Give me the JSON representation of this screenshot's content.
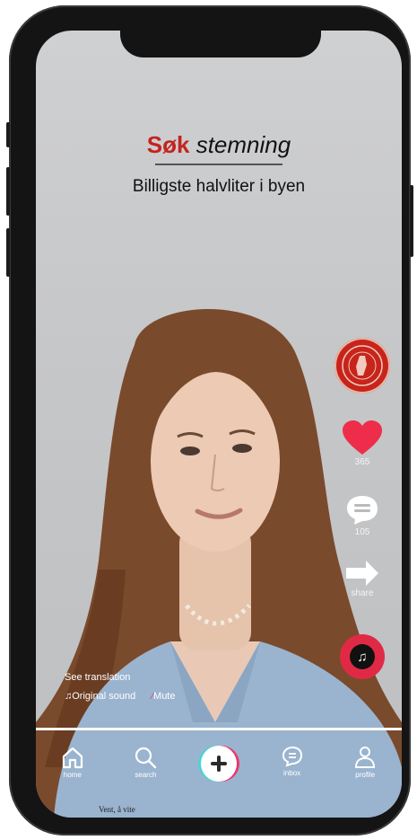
{
  "overlay": {
    "brand": "Søk",
    "brand_rest": "stemning",
    "subtitle": "Billigste halvliter i byen"
  },
  "rail": {
    "likes": "365",
    "comments": "105",
    "share_label": "share"
  },
  "captions": {
    "see_translation": "See translation",
    "original_sound": "Original sound",
    "mute": "Mute"
  },
  "nav": {
    "home": "home",
    "search": "search",
    "inbox": "inbox",
    "profile": "profile"
  },
  "footnote": "Vent, å vite"
}
